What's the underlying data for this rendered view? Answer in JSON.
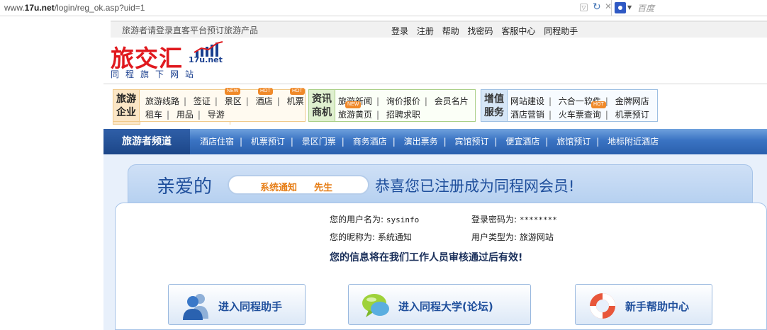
{
  "browser": {
    "url_prefix": "www.",
    "url_domain": "17u.net",
    "url_path": "/login/reg_ok.asp?uid=1",
    "search_placeholder": "百度"
  },
  "topbar": {
    "notice": "旅游者请登录直客平台预订旅游产品",
    "links": [
      "登录",
      "注册",
      "帮助",
      "找密码",
      "客服中心",
      "同程助手"
    ]
  },
  "logo": {
    "cn": "旅交汇",
    "net": "17u.net",
    "sub": "同程旗下网站"
  },
  "categories": {
    "c1": {
      "title": [
        "旅游",
        "企业"
      ],
      "row1": [
        "旅游线路",
        "签证",
        "景区",
        "酒店",
        "机票"
      ],
      "row2": [
        "租车",
        "用品",
        "导游"
      ],
      "badges": [
        "NEW",
        "HOT",
        "HOT"
      ]
    },
    "c2": {
      "title": [
        "资讯",
        "商机"
      ],
      "row1": [
        "旅游新闻",
        "询价报价",
        "会员名片"
      ],
      "row2": [
        "旅游黄页",
        "招聘求职"
      ],
      "badges": [
        "NEW"
      ]
    },
    "c3": {
      "title": [
        "增值",
        "服务"
      ],
      "row1": [
        "网站建设",
        "六合一软件",
        "金牌网店"
      ],
      "row2": [
        "酒店营销",
        "火车票查询",
        "机票预订"
      ],
      "badges": [
        "HOT"
      ]
    }
  },
  "nav": {
    "main": "旅游者频道",
    "items": [
      "酒店住宿",
      "机票预订",
      "景区门票",
      "商务酒店",
      "演出票务",
      "宾馆预订",
      "便宜酒店",
      "旅馆预订",
      "地标附近酒店"
    ]
  },
  "greeting": {
    "dear": "亲爱的",
    "name": "系统通知",
    "sir": "先生",
    "message": "恭喜您已注册成为同程网会员!"
  },
  "info": {
    "username_label": "您的用户名为:",
    "username": "sysinfo",
    "password_label": "登录密码为:",
    "password": "********",
    "nickname_label": "您的昵称为:",
    "nickname": "系统通知",
    "usertype_label": "用户类型为:",
    "usertype": "旅游网站",
    "notice": "您的信息将在我们工作人员审核通过后有效!"
  },
  "buttons": {
    "assistant": "进入同程助手",
    "university": "进入同程大学(论坛)",
    "help": "新手帮助中心"
  },
  "colors": {
    "nav_blue": "#3a73c3",
    "logo_red": "#e0191e",
    "highlight_orange": "#e67e17"
  }
}
